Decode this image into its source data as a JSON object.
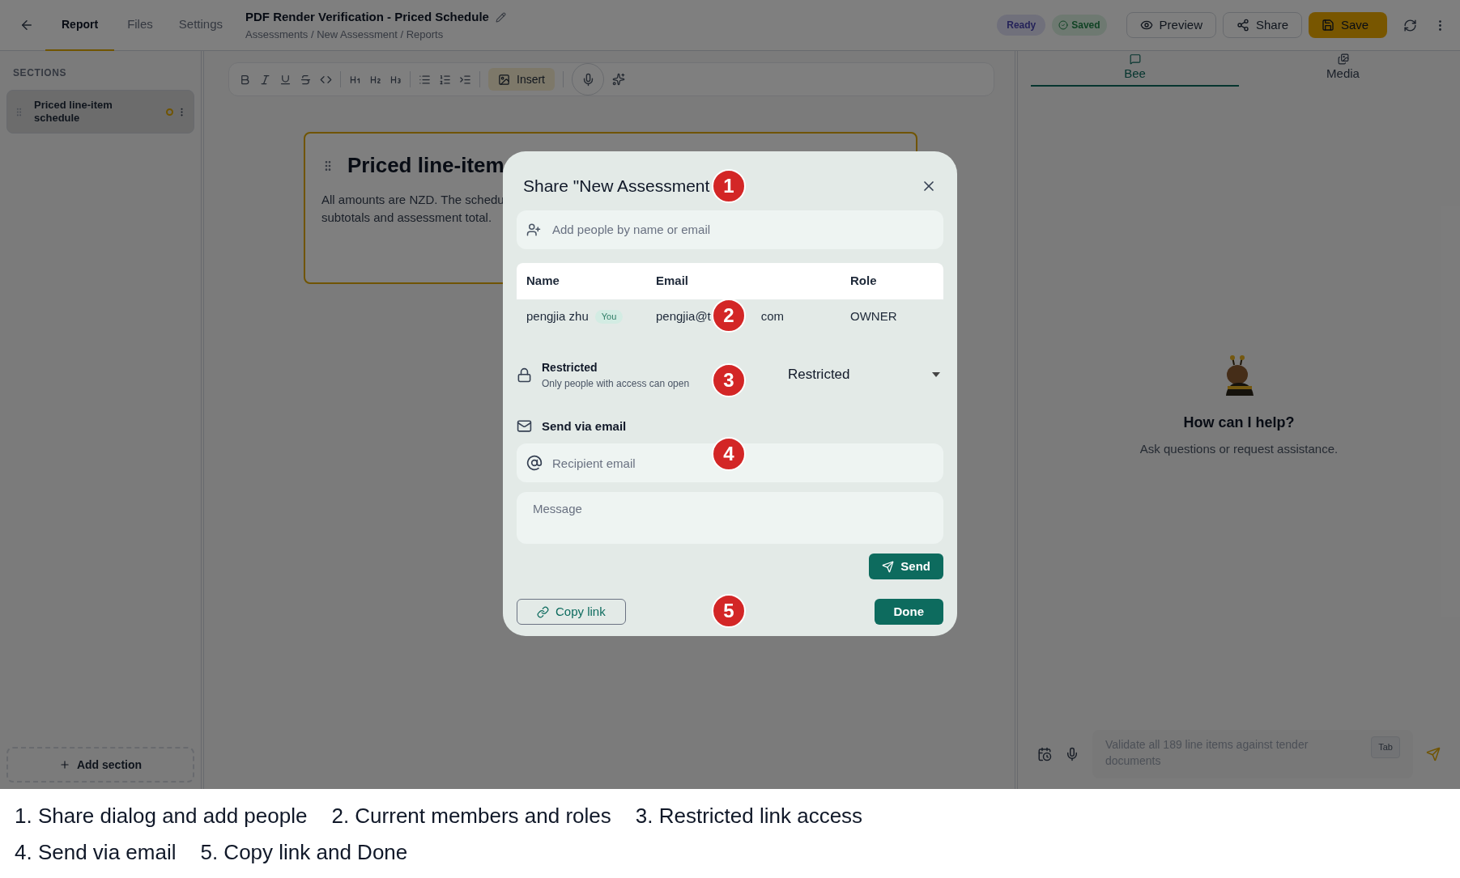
{
  "top_bar": {
    "tabs": [
      {
        "label": "Report",
        "selected": true
      },
      {
        "label": "Files",
        "selected": false
      },
      {
        "label": "Settings",
        "selected": false
      }
    ],
    "document_title": "PDF Render Verification - Priced Schedule",
    "breadcrumb": "Assessments / New Assessment / Reports",
    "badges": [
      {
        "label": "Ready",
        "kind": "info"
      },
      {
        "label": "Saved",
        "kind": "success"
      }
    ],
    "buttons": [
      {
        "label": "Preview",
        "kind": "preview"
      },
      {
        "label": "Share",
        "kind": "share"
      },
      {
        "label": "Save",
        "kind": "save"
      }
    ]
  },
  "sidebar": {
    "heading": "SECTIONS",
    "sections": [
      {
        "title": "Priced line-item schedule",
        "selected": true
      }
    ],
    "add_button": "Add section"
  },
  "toolbar": {
    "insert_button": "Insert"
  },
  "editor_card": {
    "title": "Priced line-item",
    "body_lines": [
      "All amounts are NZD. The schedu",
      "subtotals and assessment total."
    ]
  },
  "assistant": {
    "tabs": [
      {
        "label": "Bee",
        "kind": "chat",
        "selected": true
      },
      {
        "label": "Media",
        "kind": "media",
        "selected": false
      }
    ],
    "heading": "How can I help?",
    "subtitle": "Ask questions or request assistance.",
    "input_placeholder": "Validate all 189 line items against tender documents",
    "tab_key": "Tab"
  },
  "share_dialog": {
    "title": "Share \"New Assessment",
    "add_people_placeholder": "Add people by name or email",
    "columns": [
      "Name",
      "Email",
      "Role"
    ],
    "members": [
      {
        "name": "pengjia zhu",
        "tag": "You",
        "email_parts": [
          "pengjia@t",
          "com"
        ],
        "role": "OWNER"
      }
    ],
    "access": {
      "title": "Restricted",
      "description": "Only people with access can open",
      "select_value": "Restricted"
    },
    "email_section": {
      "heading": "Send via email",
      "recipient_placeholder": "Recipient email",
      "message_placeholder": "Message",
      "send_button": "Send"
    },
    "copy_link_button": "Copy link",
    "done_button": "Done"
  },
  "callouts": [
    "1",
    "2",
    "3",
    "4",
    "5"
  ],
  "caption_lines": [
    [
      "1. Share dialog and add people",
      "2. Current members and roles",
      "3. Restricted link access"
    ],
    [
      "4. Send via email",
      "5. Copy link and Done"
    ]
  ]
}
